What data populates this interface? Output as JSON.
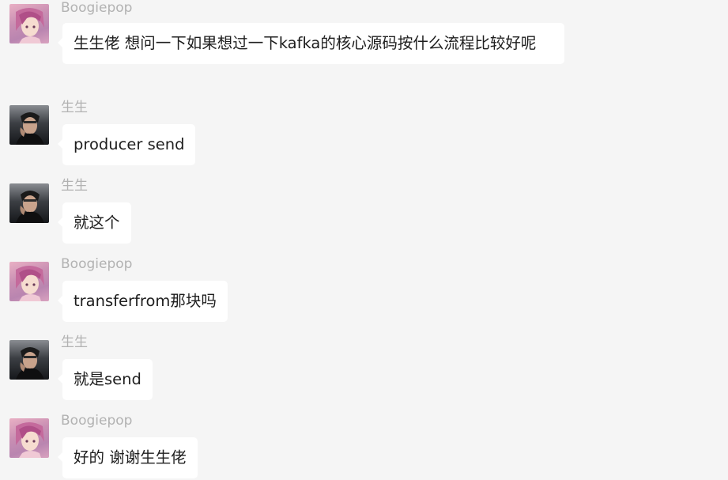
{
  "messages": [
    {
      "sender": "Boogiepop",
      "avatar": "pink-hair-avatar",
      "text": "生生佬 想问一下如果想过一下kafka的核心源码按什么流程比较好呢"
    },
    {
      "sender": "生生",
      "avatar": "dark-portrait-avatar",
      "text": "producer send"
    },
    {
      "sender": "生生",
      "avatar": "dark-portrait-avatar",
      "text": "就这个"
    },
    {
      "sender": "Boogiepop",
      "avatar": "pink-hair-avatar",
      "text": "transferfrom那块吗"
    },
    {
      "sender": "生生",
      "avatar": "dark-portrait-avatar",
      "text": "就是send"
    },
    {
      "sender": "Boogiepop",
      "avatar": "pink-hair-avatar",
      "text": "好的 谢谢生生佬"
    }
  ]
}
